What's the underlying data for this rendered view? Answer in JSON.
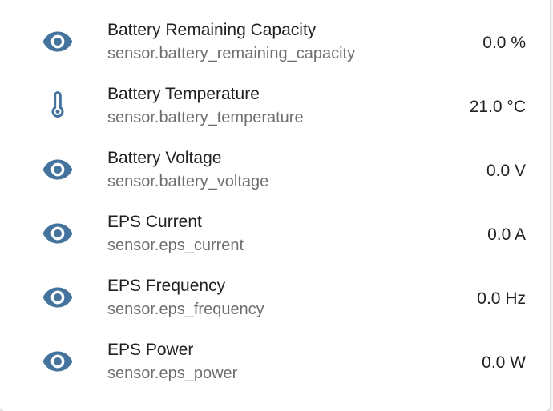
{
  "theme": {
    "icon_color": "#44739e"
  },
  "entities": [
    {
      "icon": "eye-icon",
      "name": "Battery Remaining Capacity",
      "entity_id": "sensor.battery_remaining_capacity",
      "value": "0.0 %"
    },
    {
      "icon": "thermometer-icon",
      "name": "Battery Temperature",
      "entity_id": "sensor.battery_temperature",
      "value": "21.0 °C"
    },
    {
      "icon": "eye-icon",
      "name": "Battery Voltage",
      "entity_id": "sensor.battery_voltage",
      "value": "0.0 V"
    },
    {
      "icon": "eye-icon",
      "name": "EPS Current",
      "entity_id": "sensor.eps_current",
      "value": "0.0 A"
    },
    {
      "icon": "eye-icon",
      "name": "EPS Frequency",
      "entity_id": "sensor.eps_frequency",
      "value": "0.0 Hz"
    },
    {
      "icon": "eye-icon",
      "name": "EPS Power",
      "entity_id": "sensor.eps_power",
      "value": "0.0 W"
    }
  ]
}
